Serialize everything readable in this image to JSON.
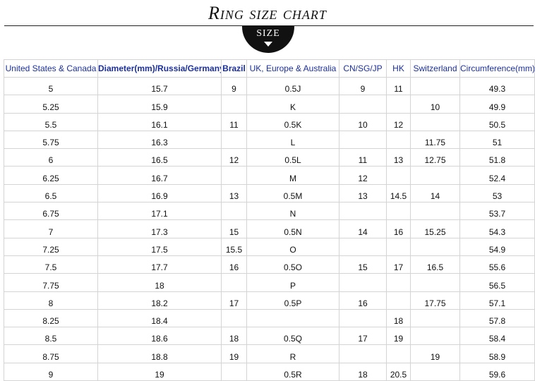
{
  "title": "Ring size chart",
  "badge": {
    "label": "SIZE",
    "icon": "arrow-down-icon"
  },
  "table": {
    "headers": [
      "United States & Canada",
      "Diameter(mm)/Russia/Germany",
      "Brazil",
      "UK, Europe & Australia",
      "CN/SG/JP",
      "HK",
      "Switzerland",
      "Circumference(mm)"
    ],
    "rows": [
      [
        "5",
        "15.7",
        "9",
        "0.5J",
        "9",
        "11",
        "",
        "49.3"
      ],
      [
        "5.25",
        "15.9",
        "",
        "K",
        "",
        "",
        "10",
        "49.9"
      ],
      [
        "5.5",
        "16.1",
        "11",
        "0.5K",
        "10",
        "12",
        "",
        "50.5"
      ],
      [
        "5.75",
        "16.3",
        "",
        "L",
        "",
        "",
        "11.75",
        "51"
      ],
      [
        "6",
        "16.5",
        "12",
        "0.5L",
        "11",
        "13",
        "12.75",
        "51.8"
      ],
      [
        "6.25",
        "16.7",
        "",
        "M",
        "12",
        "",
        "",
        "52.4"
      ],
      [
        "6.5",
        "16.9",
        "13",
        "0.5M",
        "13",
        "14.5",
        "14",
        "53"
      ],
      [
        "6.75",
        "17.1",
        "",
        "N",
        "",
        "",
        "",
        "53.7"
      ],
      [
        "7",
        "17.3",
        "15",
        "0.5N",
        "14",
        "16",
        "15.25",
        "54.3"
      ],
      [
        "7.25",
        "17.5",
        "15.5",
        "O",
        "",
        "",
        "",
        "54.9"
      ],
      [
        "7.5",
        "17.7",
        "16",
        "0.5O",
        "15",
        "17",
        "16.5",
        "55.6"
      ],
      [
        "7.75",
        "18",
        "",
        "P",
        "",
        "",
        "",
        "56.5"
      ],
      [
        "8",
        "18.2",
        "17",
        "0.5P",
        "16",
        "",
        "17.75",
        "57.1"
      ],
      [
        "8.25",
        "18.4",
        "",
        "",
        "",
        "18",
        "",
        "57.8"
      ],
      [
        "8.5",
        "18.6",
        "18",
        "0.5Q",
        "17",
        "19",
        "",
        "58.4"
      ],
      [
        "8.75",
        "18.8",
        "19",
        "R",
        "",
        "",
        "19",
        "58.9"
      ],
      [
        "9",
        "19",
        "",
        "0.5R",
        "18",
        "20.5",
        "",
        "59.6"
      ]
    ]
  }
}
